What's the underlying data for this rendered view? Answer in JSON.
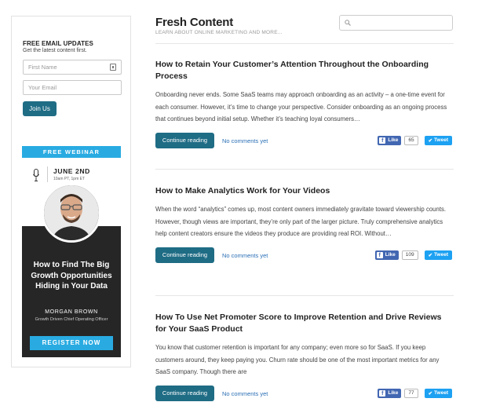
{
  "signup": {
    "title": "FREE EMAIL UPDATES",
    "subtitle": "Get the latest content first.",
    "first_name_placeholder": "First Name",
    "email_placeholder": "Your Email",
    "button": "Join Us"
  },
  "webinar": {
    "banner": "FREE WEBINAR",
    "date": "JUNE 2ND",
    "time": "10am PT, 1pm ET",
    "title": "How to Find The Big Growth Opportunities Hiding in Your Data",
    "speaker": "MORGAN BROWN",
    "role": "Growth Driven Chief Operating Officer",
    "button": "REGISTER NOW"
  },
  "header": {
    "title": "Fresh Content",
    "subtitle": "LEARN ABOUT ONLINE MARKETING AND MORE..."
  },
  "posts": [
    {
      "title": "How to Retain Your Customer’s Attention Throughout the Onboarding Process",
      "excerpt": "Onboarding never ends. Some SaaS teams may approach onboarding as an activity – a one-time event for each consumer. However, it’s time to change your perspective. Consider onboarding as an ongoing process that continues beyond initial setup. Whether it’s teaching loyal consumers…",
      "continue_label": "Continue reading",
      "comments": "No comments yet",
      "like_label": "Like",
      "like_count": "65",
      "tweet_label": "Tweet"
    },
    {
      "title": "How to Make Analytics Work for Your Videos",
      "excerpt": "When the word “analytics” comes up, most content owners immediately gravitate toward viewership counts. However, though views are important, they’re only part of the larger picture. Truly comprehensive analytics help content creators ensure the videos they produce are providing real ROI. Without…",
      "continue_label": "Continue reading",
      "comments": "No comments yet",
      "like_label": "Like",
      "like_count": "109",
      "tweet_label": "Tweet"
    },
    {
      "title": "How To Use Net Promoter Score to Improve Retention and Drive Reviews for Your SaaS Product",
      "excerpt": "You know that customer retention is important for any company; even more so for SaaS. If you keep customers around, they keep paying you. Churn rate should be one of the most important metrics for any SaaS company. Though there are",
      "continue_label": "Continue reading",
      "comments": "No comments yet",
      "like_label": "Like",
      "like_count": "77",
      "tweet_label": "Tweet"
    }
  ],
  "colors": {
    "accent": "#1f6c85",
    "webinar_blue": "#29abe2",
    "facebook": "#4267b2",
    "twitter": "#1da1f2",
    "link": "#2a6fb5"
  }
}
